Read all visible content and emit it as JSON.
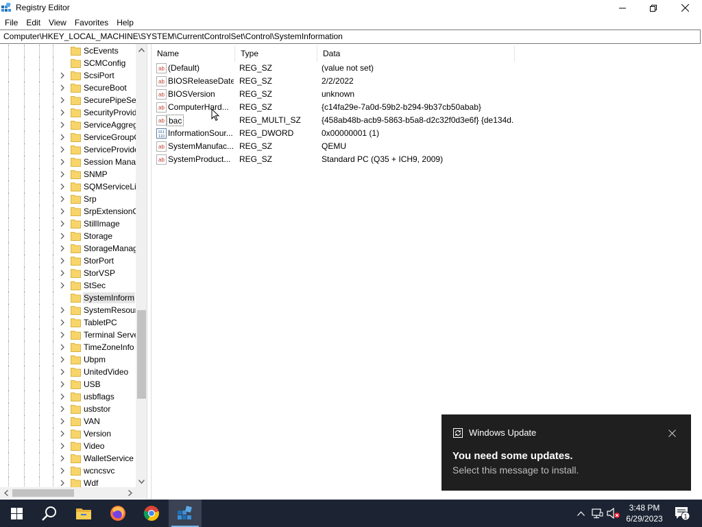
{
  "window": {
    "title": "Registry Editor",
    "icon": "regedit-icon",
    "controls": [
      "minimize-icon",
      "maximize-icon",
      "close-icon"
    ]
  },
  "menu": {
    "items": [
      "File",
      "Edit",
      "View",
      "Favorites",
      "Help"
    ]
  },
  "address": {
    "path": "Computer\\HKEY_LOCAL_MACHINE\\SYSTEM\\CurrentControlSet\\Control\\SystemInformation"
  },
  "tree": {
    "items": [
      {
        "label": "ScEvents",
        "expandable": false
      },
      {
        "label": "SCMConfig",
        "expandable": false
      },
      {
        "label": "ScsiPort",
        "expandable": true
      },
      {
        "label": "SecureBoot",
        "expandable": true
      },
      {
        "label": "SecurePipeSer",
        "expandable": true
      },
      {
        "label": "SecurityProvid",
        "expandable": true
      },
      {
        "label": "ServiceAggreg",
        "expandable": true
      },
      {
        "label": "ServiceGroupO",
        "expandable": true
      },
      {
        "label": "ServiceProvide",
        "expandable": true
      },
      {
        "label": "Session Manag",
        "expandable": true
      },
      {
        "label": "SNMP",
        "expandable": true
      },
      {
        "label": "SQMServiceLis",
        "expandable": true
      },
      {
        "label": "Srp",
        "expandable": true
      },
      {
        "label": "SrpExtensionC",
        "expandable": true
      },
      {
        "label": "StillImage",
        "expandable": true
      },
      {
        "label": "Storage",
        "expandable": true
      },
      {
        "label": "StorageManag",
        "expandable": true
      },
      {
        "label": "StorPort",
        "expandable": true
      },
      {
        "label": "StorVSP",
        "expandable": true
      },
      {
        "label": "StSec",
        "expandable": true
      },
      {
        "label": "SystemInform",
        "expandable": false,
        "selected": true
      },
      {
        "label": "SystemResour",
        "expandable": true
      },
      {
        "label": "TabletPC",
        "expandable": true
      },
      {
        "label": "Terminal Serve",
        "expandable": true
      },
      {
        "label": "TimeZoneInfo",
        "expandable": true
      },
      {
        "label": "Ubpm",
        "expandable": true
      },
      {
        "label": "UnitedVideo",
        "expandable": true
      },
      {
        "label": "USB",
        "expandable": true
      },
      {
        "label": "usbflags",
        "expandable": true
      },
      {
        "label": "usbstor",
        "expandable": true
      },
      {
        "label": "VAN",
        "expandable": true
      },
      {
        "label": "Version",
        "expandable": true
      },
      {
        "label": "Video",
        "expandable": true
      },
      {
        "label": "WalletService",
        "expandable": true
      },
      {
        "label": "wcncsvc",
        "expandable": true
      },
      {
        "label": "Wdf",
        "expandable": true
      }
    ]
  },
  "values": {
    "columns": {
      "name": "Name",
      "type": "Type",
      "data": "Data"
    },
    "rows": [
      {
        "icon": "string-value-icon",
        "name": "(Default)",
        "type": "REG_SZ",
        "data": "(value not set)"
      },
      {
        "icon": "string-value-icon",
        "name": "BIOSReleaseDate",
        "type": "REG_SZ",
        "data": "2/2/2022"
      },
      {
        "icon": "string-value-icon",
        "name": "BIOSVersion",
        "type": "REG_SZ",
        "data": "unknown"
      },
      {
        "icon": "string-value-icon",
        "name": "ComputerHard...",
        "type": "REG_SZ",
        "data": "{c14fa29e-7a0d-59b2-b294-9b37cb50abab}"
      },
      {
        "icon": "string-value-icon",
        "name": "bac",
        "type": "REG_MULTI_SZ",
        "data": "{458ab48b-acb9-5863-b5a8-d2c32f0d3e6f} {de134d...",
        "editing": true
      },
      {
        "icon": "dword-value-icon",
        "name": "InformationSour...",
        "type": "REG_DWORD",
        "data": "0x00000001 (1)"
      },
      {
        "icon": "string-value-icon",
        "name": "SystemManufac...",
        "type": "REG_SZ",
        "data": "QEMU"
      },
      {
        "icon": "string-value-icon",
        "name": "SystemProduct...",
        "type": "REG_SZ",
        "data": "Standard PC (Q35 + ICH9, 2009)"
      }
    ]
  },
  "toast": {
    "app": "Windows Update",
    "title": "You need some updates.",
    "message": "Select this message to install."
  },
  "taskbar": {
    "apps": [
      "start-icon",
      "search-icon",
      "file-explorer-icon",
      "firefox-icon",
      "chrome-icon",
      "regedit-icon"
    ],
    "time": "3:48 PM",
    "date": "6/29/2023",
    "notifications": "1"
  },
  "colors": {
    "taskbar": "#1c2433",
    "toast": "#1f1f1f",
    "selection": "#e5e5e5",
    "folder": "#f7d56a"
  }
}
